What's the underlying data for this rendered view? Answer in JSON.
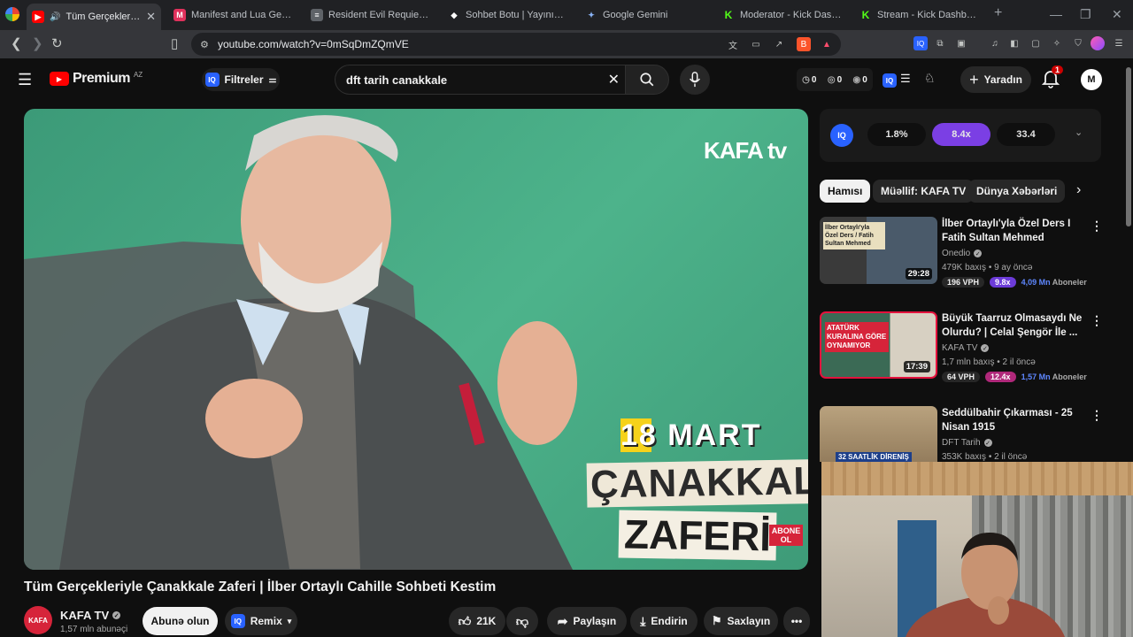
{
  "browser": {
    "tabs": [
      {
        "label": "Tüm Gerçekleriyle Çanakkale Zaferi",
        "icon": "youtube-icon",
        "color": "#ff0000",
        "active": true
      },
      {
        "label": "Manifest and Lua Generator | Wa",
        "icon": "manifest-icon",
        "color": "#e0315c",
        "active": false
      },
      {
        "label": "Resident Evil Requiem Price history",
        "icon": "steamdb-icon",
        "color": "#c9ccd1",
        "active": false
      },
      {
        "label": "Sohbet Botu | Yayınını güçlendim",
        "icon": "bot-icon",
        "color": "#ffffff",
        "active": false
      },
      {
        "label": "Google Gemini",
        "icon": "gemini-icon",
        "color": "#8ab4f8",
        "active": false
      },
      {
        "label": "Moderator - Kick Dashboard",
        "icon": "kick-icon",
        "color": "#53fc18",
        "active": false
      },
      {
        "label": "Stream - Kick Dashboard",
        "icon": "kick-icon",
        "color": "#53fc18",
        "active": false
      }
    ],
    "url": "youtube.com/watch?v=0mSqDmZQmVE"
  },
  "header": {
    "logo_text": "Premium",
    "region": "AZ",
    "filters_label": "Filtreler",
    "search_value": "dft tarih canakkale",
    "stats": [
      "0",
      "0",
      "0"
    ],
    "create_label": "Yaradın",
    "notif_count": "1",
    "avatar_initials": "M"
  },
  "video": {
    "overlay_logo": "KAFA tv",
    "date_text": "18 MART",
    "title_line1": "ÇANAKKALE",
    "title_line2": "ZAFERİ",
    "abone": "ABONE OL",
    "title": "Tüm Gerçekleriyle Çanakkale Zaferi | İlber Ortaylı Cahille Sohbeti Kestim"
  },
  "channel": {
    "name": "KAFA TV",
    "subs": "1,57 mln abunəçi",
    "subscribe_label": "Abunə olun",
    "remix_label": "Remix"
  },
  "actions": {
    "likes": "21K",
    "share": "Paylaşın",
    "download": "Endirin",
    "save": "Saxlayın"
  },
  "iq_stats": [
    "1.8%",
    "8.4x",
    "33.4"
  ],
  "chips": [
    "Hamısı",
    "Müəllif: KAFA TV",
    "Dünya Xəbərləri"
  ],
  "recommendations": [
    {
      "title": "İlber Ortaylı'yla Özel Ders I Fatih Sultan Mehmed",
      "channel": "Onedio",
      "meta": "479K baxış • 9 ay öncə",
      "duration": "29:28",
      "vph": "196 VPH",
      "mult": "9.8x",
      "subs": "4,09 Mn",
      "subs_label": "Aboneler",
      "thumb_text": "İlber Ortaylı'yla Özel Ders / Fatih Sultan Mehmed"
    },
    {
      "title": "Büyük Taarruz Olmasaydı Ne Olurdu? | Celal Şengör İle ...",
      "channel": "KAFA TV",
      "meta": "1,7 mln baxış • 2 il öncə",
      "duration": "17:39",
      "vph": "64 VPH",
      "mult": "12.4x",
      "subs": "1,57 Mn",
      "subs_label": "Aboneler",
      "thumb_text": "ATATÜRK KURALINA GÖRE OYNAMIYOR"
    },
    {
      "title": "Seddülbahir Çıkarması - 25 Nisan 1915",
      "channel": "DFT Tarih",
      "meta": "353K baxış • 2 il öncə",
      "thumb_text": "32 SAATLİK DİRENİŞ"
    }
  ]
}
